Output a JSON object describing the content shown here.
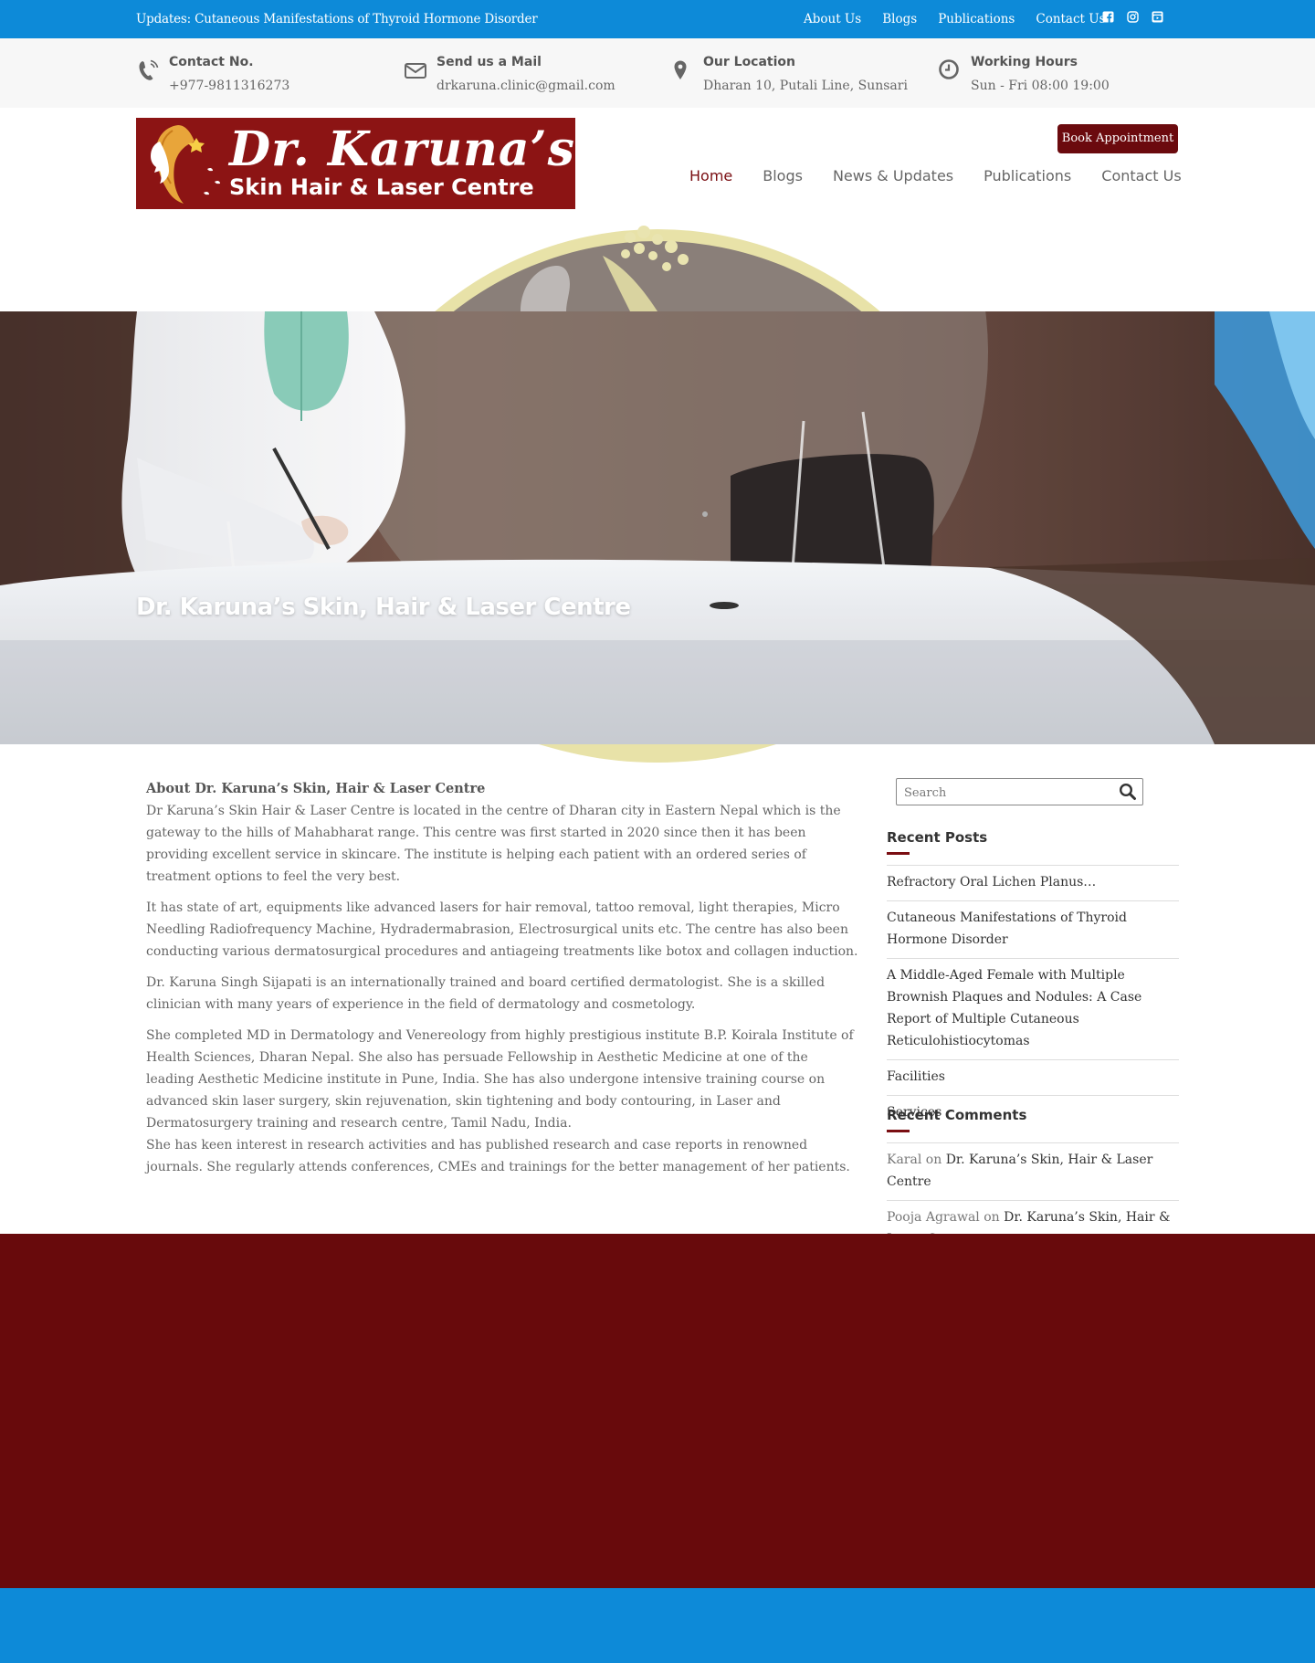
{
  "topbar": {
    "updates": "Updates: Cutaneous Manifestations of Thyroid Hormone Disorder",
    "links": [
      "About Us",
      "Blogs",
      "Publications",
      "Contact Us"
    ],
    "social_icons": [
      "facebook-icon",
      "instagram-icon",
      "youtube-icon"
    ]
  },
  "info": [
    {
      "label": "Contact No.",
      "value": "+977-9811316273",
      "icon": "phone-icon"
    },
    {
      "label": "Send us a Mail",
      "value": "drkaruna.clinic@gmail.com",
      "icon": "mail-icon"
    },
    {
      "label": "Our Location",
      "value": "Dharan 10, Putali Line, Sunsari",
      "icon": "location-pin-icon"
    },
    {
      "label": "Working Hours",
      "value": "Sun - Fri 08:00 19:00",
      "icon": "clock-icon"
    }
  ],
  "logo": {
    "line1": "Dr. Karuna’s",
    "line2": "Skin Hair & Laser Centre"
  },
  "book_button": "Book Appointment",
  "nav": [
    "Home",
    "Blogs",
    "News & Updates",
    "Publications",
    "Contact Us"
  ],
  "nav_active": "Home",
  "hero": {
    "title": "Dr. Karuna’s Skin, Hair & Laser Centre"
  },
  "content": {
    "heading": "About Dr. Karuna’s Skin, Hair & Laser Centre",
    "p1": "Dr Karuna’s Skin Hair & Laser Centre is located in the centre of Dharan city in Eastern Nepal which is the gateway to the hills of Mahabharat range. This centre was first started in 2020 since then it has been providing excellent service in skincare. The institute is helping each patient with an ordered series of treatment options to feel the very best.",
    "p2": "It has state of art, equipments like advanced lasers for hair removal, tattoo removal, light therapies, Micro Needling Radiofrequency Machine, Hydradermabrasion, Electrosurgical units etc. The centre has also been conducting various dermatosurgical procedures and antiageing treatments like botox and collagen induction.",
    "p3": "Dr. Karuna Singh Sijapati is an internationally trained and board certified dermatologist. She is a skilled clinician with many years of experience in the field of dermatology and cosmetology.",
    "p4": "She completed MD in Dermatology and Venereology from highly prestigious institute B.P. Koirala Institute of Health Sciences, Dharan Nepal. She also has persuade Fellowship in Aesthetic Medicine at one of the leading Aesthetic Medicine institute in Pune, India. She has also undergone intensive training course on advanced skin laser surgery, skin rejuvenation, skin tightening and body contouring, in Laser and Dermatosurgery training and research centre, Tamil Nadu, India.",
    "p5": "She has keen interest in research activities and has published research and case reports in renowned journals. She regularly attends conferences, CMEs and trainings for the better management of her patients."
  },
  "sidebar": {
    "search_placeholder": "Search",
    "recent_posts_title": "Recent Posts",
    "recent_posts": [
      "Refractory Oral Lichen Planus…",
      "Cutaneous Manifestations of Thyroid Hormone Disorder",
      "A Middle-Aged Female with Multiple Brownish Plaques and Nodules: A Case Report of Multiple Cutaneous Reticulohistiocytomas",
      "Facilities",
      "Services"
    ],
    "recent_comments_title": "Recent Comments",
    "recent_comments": [
      {
        "author": "Karal",
        "on": "on",
        "post": "Dr. Karuna’s Skin, Hair & Laser Centre"
      },
      {
        "author": "Pooja Agrawal",
        "on": "on",
        "post": "Dr. Karuna’s Skin, Hair & Laser Centre"
      }
    ]
  },
  "colors": {
    "topbar": "#0d8ad8",
    "brand": "#6b0a0e",
    "footer": "#680a0c"
  }
}
